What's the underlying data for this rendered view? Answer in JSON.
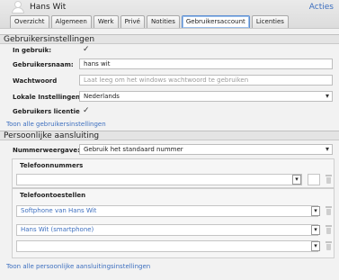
{
  "header": {
    "title": "Hans Wit",
    "actions_label": "Acties"
  },
  "tabs": [
    {
      "label": "Overzicht",
      "active": false
    },
    {
      "label": "Algemeen",
      "active": false
    },
    {
      "label": "Werk",
      "active": false
    },
    {
      "label": "Privé",
      "active": false
    },
    {
      "label": "Notities",
      "active": false
    },
    {
      "label": "Gebruikersaccount",
      "active": true
    },
    {
      "label": "Licenties",
      "active": false
    }
  ],
  "user_settings": {
    "section_title": "Gebruikersinstellingen",
    "in_use_label": "In gebruik:",
    "in_use_checked": true,
    "username_label": "Gebruikersnaam:",
    "username_value": "hans wit",
    "password_label": "Wachtwoord",
    "password_placeholder": "Laat leeg om het windows wachtwoord te gebruiken",
    "locale_label": "Lokale Instellingen:",
    "locale_value": "Nederlands",
    "license_label": "Gebruikers licentie",
    "license_checked": true,
    "show_all_link": "Toon alle gebruikersinstellingen"
  },
  "personal_connection": {
    "section_title": "Persoonlijke aansluiting",
    "number_display_label": "Nummerweergave:",
    "number_display_value": "Gebruik het standaard nummer",
    "phone_numbers_label": "Telefoonnummers",
    "phone_devices_label": "Telefoontoestellen",
    "devices": [
      "Softphone van Hans Wit",
      "Hans Wit (smartphone)",
      ""
    ],
    "show_all_link": "Toon alle persoonlijke aansluitingsinstellingen"
  },
  "icons": {
    "checkmark": "✓",
    "dropdown": "▾"
  }
}
